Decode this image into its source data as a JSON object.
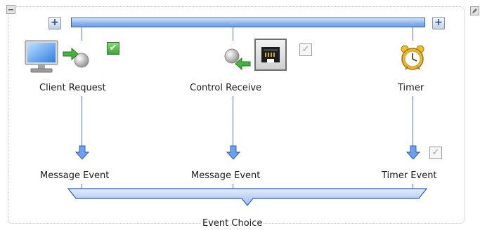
{
  "diagram": {
    "choice_label": "Event Choice",
    "top_add_left": "+",
    "top_add_right": "+",
    "collapse_symbol": "−",
    "branches": [
      {
        "source": "Client Request",
        "event": "Message Event",
        "source_checked": true,
        "event_checked": null
      },
      {
        "source": "Control Receive",
        "event": "Message Event",
        "source_checked": false,
        "event_checked": null
      },
      {
        "source": "Timer",
        "event": "Timer Event",
        "source_checked": null,
        "event_checked": false
      }
    ],
    "check_on_glyph": "✔",
    "check_off_glyph": "✓"
  },
  "colors": {
    "bar_fill": "#8fb6ef",
    "bar_border": "#2f62b3",
    "connector": "#4f7fc7",
    "arrow": "#4a86e8",
    "checkbox_on": "#3fa33a"
  },
  "icons": {
    "client": "monitor-icon",
    "send": "send-arrow-icon",
    "receive": "receive-arrow-icon",
    "network_port": "network-port-icon",
    "timer": "alarm-clock-icon",
    "event_arrow": "down-arrow-icon"
  }
}
